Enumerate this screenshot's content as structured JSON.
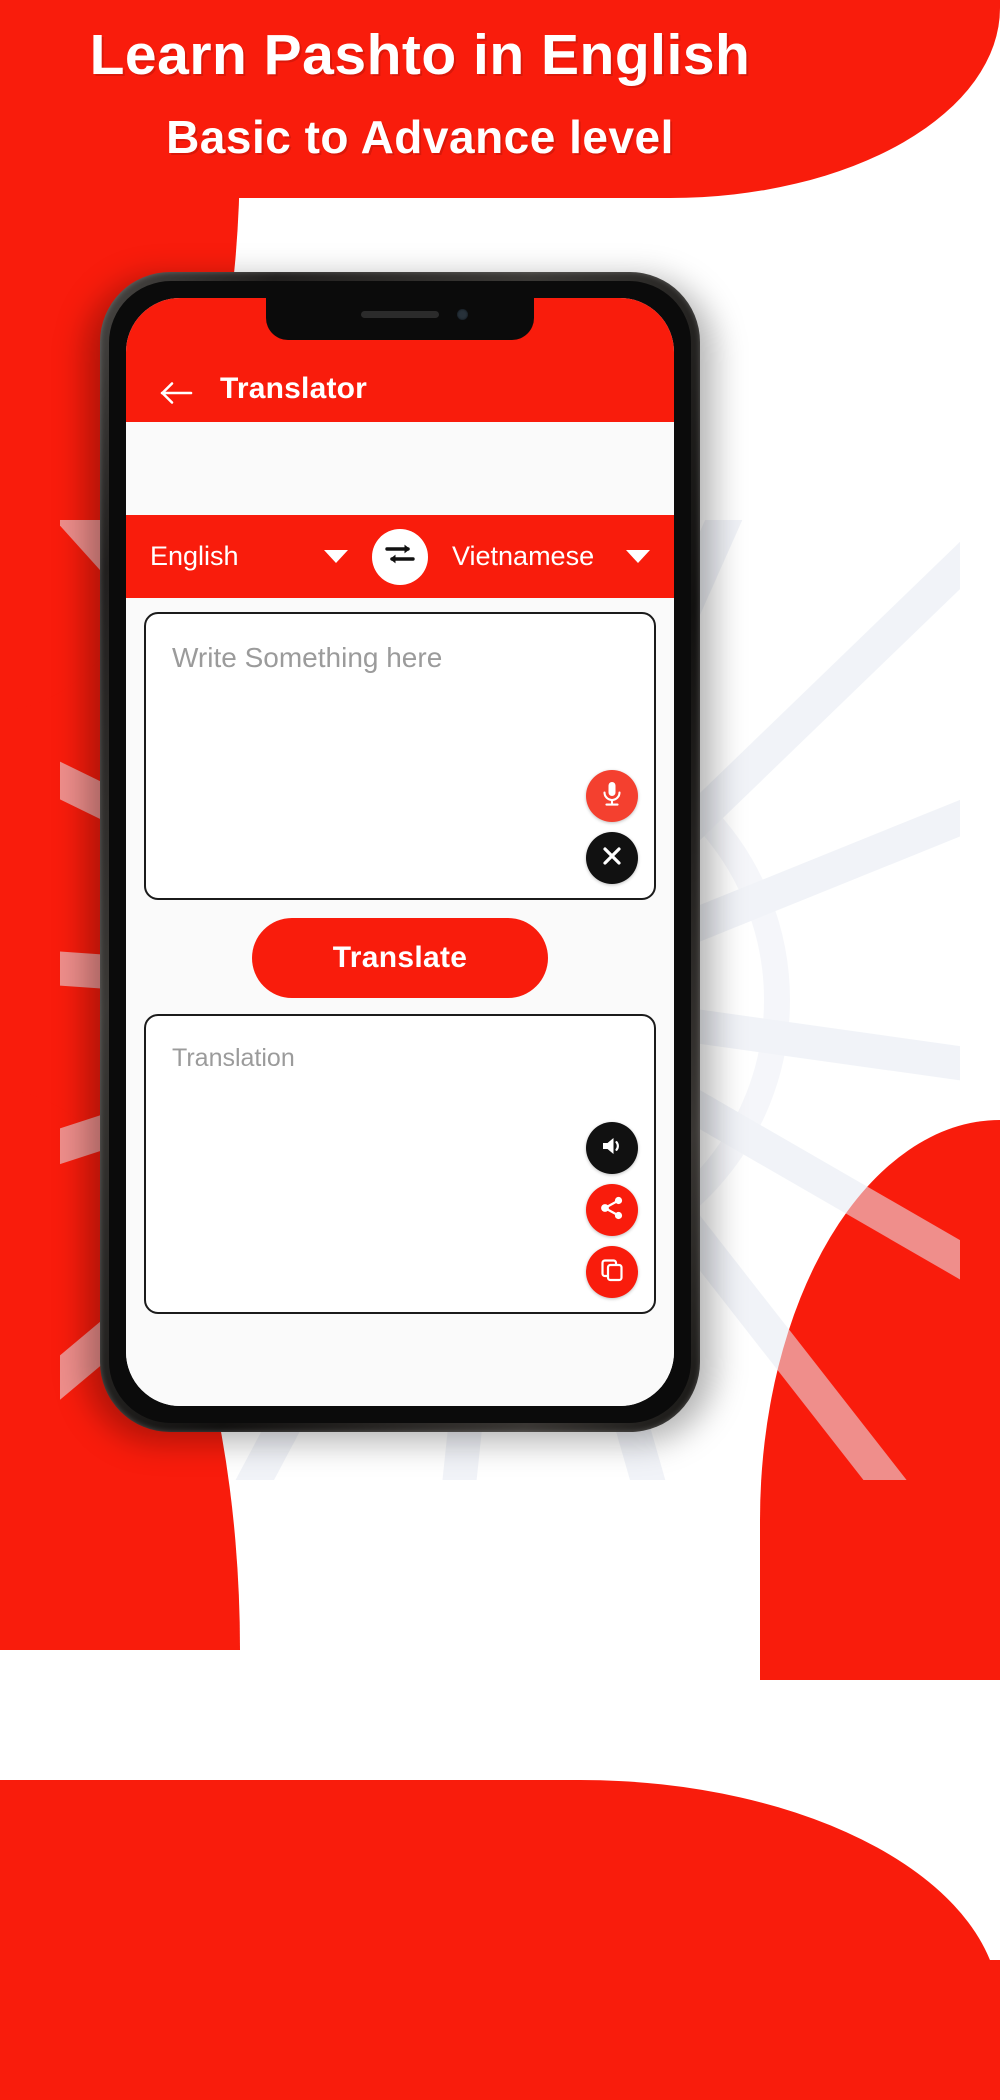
{
  "promo": {
    "headline": "Learn Pashto in English",
    "subheadline": "Basic to Advance level",
    "brand_color": "#F91C0C",
    "accent_black": "#111111"
  },
  "app": {
    "appbar": {
      "back_icon": "arrow-left-icon",
      "title": "Translator"
    },
    "language_bar": {
      "source_language": "English",
      "target_language": "Vietnamese",
      "source_caret_icon": "chevron-down-icon",
      "target_caret_icon": "chevron-down-icon",
      "swap_icon": "swap-horizontal-icon"
    },
    "input_area": {
      "placeholder": "Write Something here",
      "value": "",
      "mic_icon": "microphone-icon",
      "clear_icon": "close-x-icon"
    },
    "translate_button": {
      "label": "Translate"
    },
    "output_area": {
      "placeholder": "Translation",
      "value": "",
      "speak_icon": "speaker-volume-icon",
      "share_icon": "share-nodes-icon",
      "copy_icon": "copy-icon"
    }
  }
}
